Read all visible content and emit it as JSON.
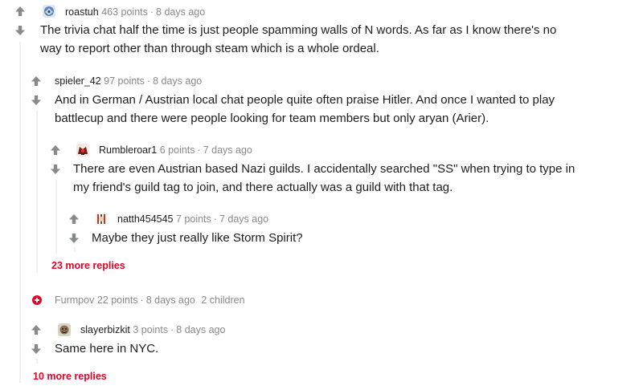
{
  "comments": [
    {
      "author": "roastuh",
      "points": "463 points",
      "sep": "·",
      "age": "8 days ago",
      "text_lines": [
        "The trivia chat half the time is just people spamming walls of N words. As far as I know there's no",
        "way to report other than through steam which is a whole ordeal."
      ]
    },
    {
      "author": "spieler_42",
      "points": "97 points",
      "sep": "·",
      "age": "8 days ago",
      "text_lines": [
        "And in German / Austrian local chat people quite often praise Hitler. And once I wanted to play",
        "battlecup and there were people looking for team members but only aryan (Arier)."
      ]
    },
    {
      "author": "Rumbleroar1",
      "points": "6 points",
      "sep": "·",
      "age": "7 days ago",
      "text_lines": [
        "There are even Austrian based Nazi guilds. I accidentally searched \"SS\" when trying to type in",
        "my friend's guild tag to join, and there actually was a guild with that tag."
      ]
    },
    {
      "author": "natth454545",
      "points": "7 points",
      "sep": "·",
      "age": "7 days ago",
      "text_lines": [
        "Maybe they just really like Storm Spirit?"
      ]
    },
    {
      "author": "slayerbizkit",
      "points": "3 points",
      "sep": "·",
      "age": "8 days ago",
      "text_lines": [
        "Same here in NYC."
      ]
    }
  ],
  "collapsed": {
    "author": "Furmpov",
    "points": "22 points",
    "sep": "·",
    "age": "8 days ago",
    "children": "2 children"
  },
  "more_replies": {
    "level3": "23 more replies",
    "level1": "10 more replies"
  },
  "colors": {
    "upvote_arrow": "#878a8c",
    "thread_line": "#edeff1",
    "more_replies": "#ea0027",
    "meta_text": "#878a8c"
  },
  "icons": {
    "upvote": "arrow-up-icon",
    "downvote": "arrow-down-icon",
    "expand": "plus-circle-icon"
  }
}
